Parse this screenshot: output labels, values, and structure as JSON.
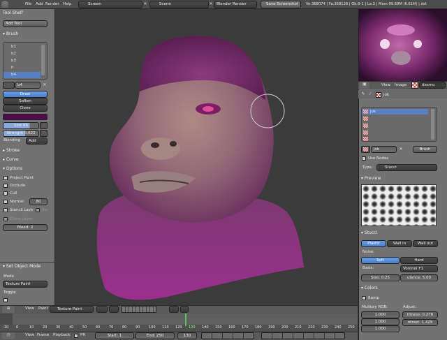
{
  "topbar": {
    "menus": [
      "File",
      "Add",
      "Render",
      "Help"
    ],
    "screen_layout": "Screen",
    "scene": "Scene",
    "render_engine": "Blender Render",
    "save_screenshot": "Save Screenshot",
    "stats": "Ve:368074 | Fa:368128 | Ob:9-1 | La:3 | Mem:99.69M (6.61M) | dst"
  },
  "toolshelf": {
    "title": "Tool Shelf",
    "add_tool": "Add Tool",
    "brush_header": "Brush",
    "brushes": [
      "b1",
      "b2",
      "b3",
      "h",
      "b4"
    ],
    "brush_name": "b4",
    "modes": [
      "Draw",
      "Soften",
      "Clone"
    ],
    "size_label": "Size",
    "size_value": "96",
    "strength_label": "Strength",
    "strength_value": "0.622",
    "blending_label": "Blending",
    "blending_value": "Add",
    "stroke_header": "Stroke",
    "curve_header": "Curve",
    "options_header": "Options",
    "project_paint": "Project Paint",
    "occlude": "Occlude",
    "cull": "Cull",
    "normal": "Normal",
    "normal_value": "80",
    "stencil_layer": "Stencil Laye",
    "inv": "Inv",
    "clone_layer": "Clone Layer",
    "bleed": "Bleed: 2"
  },
  "operator": {
    "title": "Set Object Mode",
    "mode_label": "Mode",
    "mode_value": "Texture Paint",
    "toggle_label": "Toggle"
  },
  "viewport_header": {
    "view": "View",
    "paint": "Paint",
    "mode": "Texture Paint"
  },
  "timeline": {
    "ticks": [
      "-10",
      "0",
      "10",
      "20",
      "30",
      "40",
      "50",
      "60",
      "70",
      "80",
      "90",
      "100",
      "110",
      "120",
      "130",
      "140",
      "150",
      "160",
      "170",
      "180",
      "190",
      "200",
      "210",
      "220",
      "230",
      "240",
      "250"
    ],
    "current_frame_tick": "130"
  },
  "bottombar": {
    "view": "View",
    "frame": "Frame",
    "playback": "Playback",
    "pr": "PR",
    "start": "Start: 1",
    "end": "End: 250",
    "current": "130"
  },
  "properties": {
    "view": "View",
    "image": "Image",
    "dasmu": "dasmu",
    "jok": "jok",
    "texture_slots": [
      "jok",
      "",
      "",
      "",
      ""
    ],
    "texture_name": "jok",
    "brush_btn": "Brush",
    "use_nodes": "Use Nodes",
    "type_label": "Type:",
    "type_value": "Stucci",
    "preview_header": "Preview",
    "stucci_header": "Stucci",
    "stucci_types": [
      "Plastic",
      "Wall in",
      "Wall out"
    ],
    "noise_label": "Noise:",
    "noise_types": [
      "Soft",
      "Hard"
    ],
    "basis_label": "Basis:",
    "basis_value": "Voronoi F1",
    "size_field": "Size: 0.25",
    "turbulence_field": "ulence: 5.00",
    "colors_header": "Colors",
    "ramp": "Ramp",
    "multiply_rgb": "Multiply RGB:",
    "adjust": "Adjust:",
    "rgb_values": [
      "1.000",
      "1.000",
      "1.000"
    ],
    "brightness": "htness: 0.276",
    "contrast": "ntrast: 1.429"
  }
}
